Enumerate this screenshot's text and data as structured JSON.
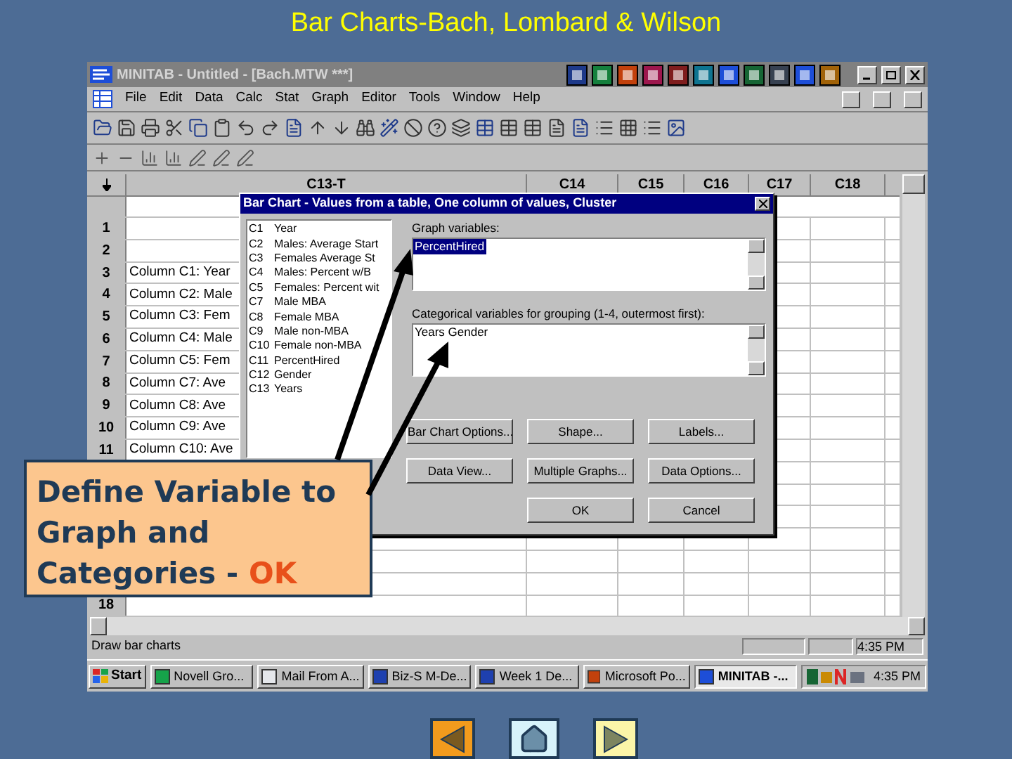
{
  "slide_title": "Bar Charts-Bach, Lombard & Wilson",
  "window": {
    "title": "MINITAB - Untitled - [Bach.MTW ***]"
  },
  "menu": [
    "File",
    "Edit",
    "Data",
    "Calc",
    "Stat",
    "Graph",
    "Editor",
    "Tools",
    "Window",
    "Help"
  ],
  "columns": [
    "C13-T",
    "C14",
    "C15",
    "C16",
    "C17",
    "C18"
  ],
  "rows": [
    {
      "number": "1"
    },
    {
      "number": "2"
    },
    {
      "number": "3",
      "cell": "Column C1:  Year"
    },
    {
      "number": "4",
      "cell": "Column C2:  Male"
    },
    {
      "number": "5",
      "cell": "Column C3:  Fem"
    },
    {
      "number": "6",
      "cell": "Column C4:  Male"
    },
    {
      "number": "7",
      "cell": "Column C5:  Fem"
    },
    {
      "number": "8",
      "cell": "Column C7:  Ave"
    },
    {
      "number": "9",
      "cell": "Column C8:  Ave"
    },
    {
      "number": "10",
      "cell": "Column C9:  Ave"
    },
    {
      "number": "11",
      "cell": "Column C10:  Ave"
    },
    {
      "number": "18"
    }
  ],
  "dialog": {
    "title": "Bar Chart - Values from a table, One column of values, Cluster",
    "variables": [
      {
        "code": "C1",
        "name": "Year"
      },
      {
        "code": "C2",
        "name": "Males: Average Start"
      },
      {
        "code": "C3",
        "name": "Females Average St"
      },
      {
        "code": "C4",
        "name": "Males: Percent w/B"
      },
      {
        "code": "C5",
        "name": "Females: Percent wit"
      },
      {
        "code": "C7",
        "name": "Male MBA"
      },
      {
        "code": "C8",
        "name": "Female MBA"
      },
      {
        "code": "C9",
        "name": "Male non-MBA"
      },
      {
        "code": "C10",
        "name": "Female non-MBA"
      },
      {
        "code": "C11",
        "name": "PercentHired"
      },
      {
        "code": "C12",
        "name": "Gender"
      },
      {
        "code": "C13",
        "name": "Years"
      }
    ],
    "graph_label": "Graph variables:",
    "graph_value": "PercentHired",
    "category_label": "Categorical variables for grouping (1-4, outermost first):",
    "category_value": "Years Gender",
    "buttons": [
      "Bar Chart Options...",
      "Shape...",
      "Labels...",
      "Data View...",
      "Multiple Graphs...",
      "Data Options...",
      "OK",
      "Cancel"
    ]
  },
  "callout": {
    "text": "Define Variable to Graph and Categories - ",
    "emphasis": "OK"
  },
  "status_bar": {
    "message": "Draw bar charts",
    "time": "4:35 PM"
  },
  "taskbar": {
    "start": "Start",
    "tasks": [
      {
        "label": "Novell Gro...",
        "selected": false
      },
      {
        "label": "Mail From A...",
        "selected": false
      },
      {
        "label": "Biz-S M-De...",
        "selected": false
      },
      {
        "label": "Week 1 De...",
        "selected": false
      },
      {
        "label": "Microsoft Po...",
        "selected": false
      },
      {
        "label": "MINITAB -...",
        "selected": true
      }
    ],
    "clock": "4:35 PM"
  }
}
